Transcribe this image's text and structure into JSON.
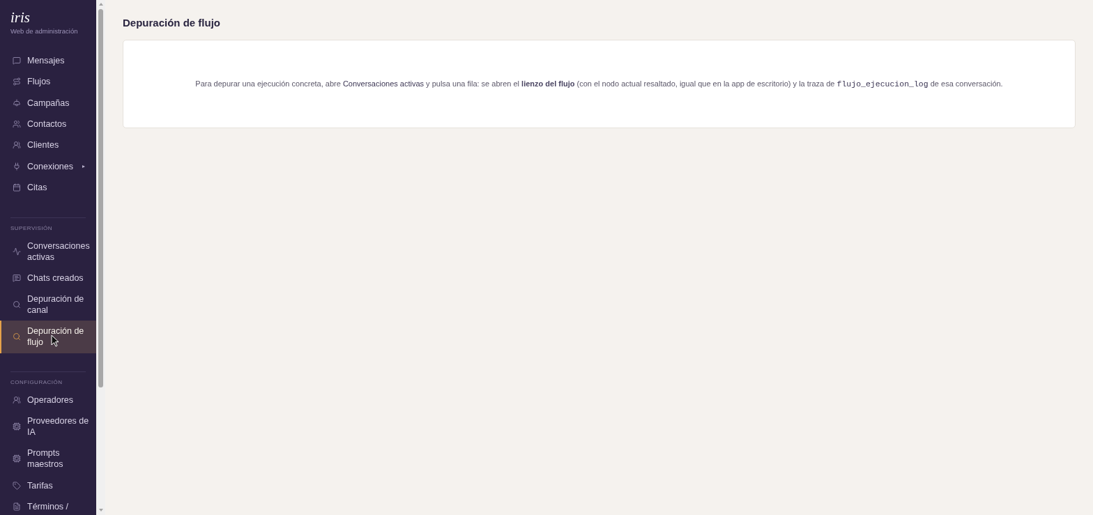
{
  "sidebar": {
    "logo": "iris",
    "subtitle": "Web de administración",
    "sections": [
      {
        "items": [
          {
            "kind": "link",
            "label": "Mensajes",
            "selected": false
          },
          {
            "kind": "link",
            "label": "Flujos",
            "selected": false
          },
          {
            "kind": "link",
            "label": "Campañas",
            "selected": false
          },
          {
            "kind": "link",
            "label": "Contactos",
            "selected": false
          },
          {
            "kind": "link",
            "label": "Clientes",
            "selected": false
          },
          {
            "kind": "group",
            "label": "Conexiones",
            "selected": false,
            "expanded": false
          },
          {
            "kind": "link",
            "label": "Citas",
            "selected": false
          }
        ]
      },
      {
        "heading": "SUPERVISIÓN",
        "items": [
          {
            "kind": "link",
            "label": "Conversaciones activas",
            "selected": false
          },
          {
            "kind": "link",
            "label": "Chats creados",
            "selected": false
          },
          {
            "kind": "link",
            "label": "Depuración de canal",
            "selected": false
          },
          {
            "kind": "link",
            "label": "Depuración de flujo",
            "selected": true
          }
        ]
      },
      {
        "heading": "CONFIGURACIÓN",
        "items": [
          {
            "kind": "link",
            "label": "Operadores",
            "selected": false
          },
          {
            "kind": "link",
            "label": "Proveedores de IA",
            "selected": false
          },
          {
            "kind": "link",
            "label": "Prompts maestros",
            "selected": false
          },
          {
            "kind": "link",
            "label": "Tarifas",
            "selected": false
          },
          {
            "kind": "link",
            "label": "Términos /",
            "selected": false
          }
        ]
      }
    ]
  },
  "page": {
    "title": "Depuración de flujo",
    "notice": [
      {
        "kind": "text",
        "text": "Para depurar una ejecución concreta, abre "
      },
      {
        "kind": "link",
        "text": "Conversaciones activas"
      },
      {
        "kind": "text",
        "text": " y pulsa una fila: se abren el "
      },
      {
        "kind": "strong",
        "text": "lienzo del flujo"
      },
      {
        "kind": "text",
        "text": " (con el nodo actual resaltado, igual que en la app de escritorio) y la traza de "
      },
      {
        "kind": "code",
        "text": "flujo_ejecucion_log"
      },
      {
        "kind": "text",
        "text": " de esa conversación."
      }
    ]
  }
}
